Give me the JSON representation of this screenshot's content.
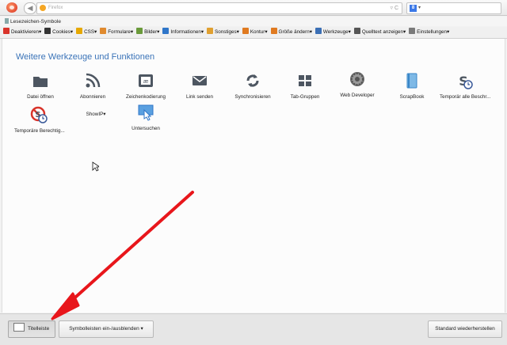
{
  "nav": {
    "back_glyph": "◀",
    "url_text": "Firefox",
    "url_right": "▿ C",
    "search_engine": "8",
    "search_dropdown": "▾"
  },
  "bookmarks": {
    "label": "Lesezeichen-Symbole"
  },
  "toolbar": {
    "items": [
      {
        "label": "Deaktivieren▾",
        "color": "#d9342b"
      },
      {
        "label": "Cookies▾",
        "color": "#333333"
      },
      {
        "label": "CSS▾",
        "color": "#e6a800"
      },
      {
        "label": "Formulare▾",
        "color": "#e08a2e"
      },
      {
        "label": "Bilder▾",
        "color": "#6a9a3a"
      },
      {
        "label": "Informationen▾",
        "color": "#2f76c9"
      },
      {
        "label": "Sonstiges▾",
        "color": "#e0a030"
      },
      {
        "label": "Kontur▾",
        "color": "#e07a20"
      },
      {
        "label": "Größe ändern▾",
        "color": "#e07a20"
      },
      {
        "label": "Werkzeuge▾",
        "color": "#3b6fb5"
      },
      {
        "label": "Quelltext anzeigen▾",
        "color": "#555555"
      },
      {
        "label": "Einstellungen▾",
        "color": "#7a7a7a"
      }
    ]
  },
  "panel": {
    "title": "Weitere Werkzeuge und Funktionen",
    "items": [
      {
        "label": "Datei öffnen",
        "icon": "folder-icon"
      },
      {
        "label": "Abonnieren",
        "icon": "rss-icon"
      },
      {
        "label": "Zeichenkodierung",
        "icon": "encoding-icon"
      },
      {
        "label": "Link senden",
        "icon": "mail-icon"
      },
      {
        "label": "Synchronisieren",
        "icon": "sync-icon"
      },
      {
        "label": "Tab-Gruppen",
        "icon": "tab-groups-icon"
      },
      {
        "label": "Web Developer",
        "icon": "gear-icon"
      },
      {
        "label": "ScrapBook",
        "icon": "scrapbook-icon"
      },
      {
        "label": "Temporär alle Beschr...",
        "icon": "script-clock-icon"
      },
      {
        "label": "Temporäre Berechtig...",
        "icon": "no-script-clock-icon"
      },
      {
        "label": "ShowIP▾",
        "icon": ""
      },
      {
        "label": "Untersuchen",
        "icon": "inspect-icon"
      }
    ]
  },
  "footer": {
    "titlebar_label": "Titelleiste",
    "toolbars_label": "Symbolleisten ein-/ausblenden ▾",
    "restore_label": "Standard wiederherstellen"
  },
  "colors": {
    "accent": "#3a73b8",
    "icon_gray": "#4d5661",
    "arrow": "#e8161b"
  }
}
